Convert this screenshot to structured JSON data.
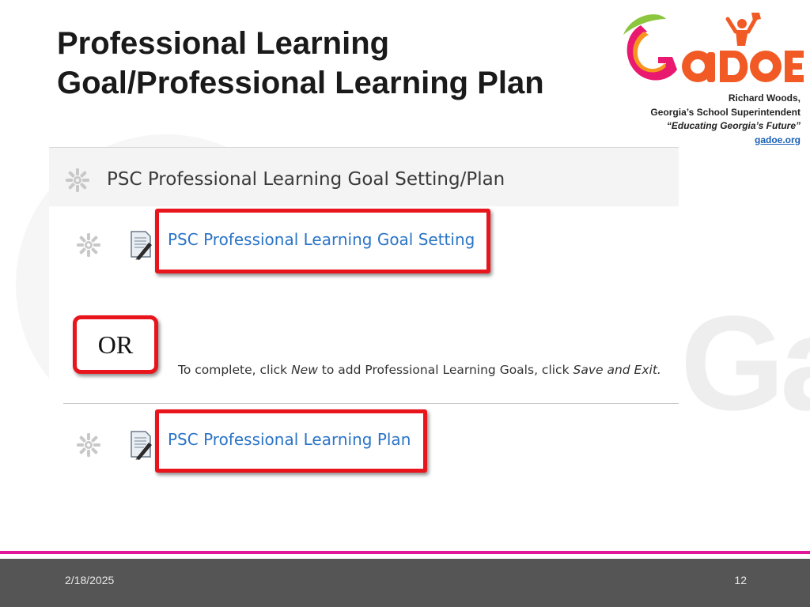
{
  "slide": {
    "title": "Professional Learning Goal/Professional Learning Plan"
  },
  "logo": {
    "icon": "gadoe-logo",
    "wordmark": "GaDOE",
    "colors": {
      "orange": "#f15a24",
      "magenta": "#d6197b",
      "green": "#8cc63f",
      "yellow": "#f7c21b"
    }
  },
  "credit": {
    "name": "Richard Woods,",
    "role": "Georgia’s School Superintendent",
    "tagline": "“Educating Georgia’s Future”",
    "link": "gadoe.org"
  },
  "screenshot": {
    "header": "PSC Professional Learning Goal Setting/Plan",
    "items": [
      {
        "label": "PSC Professional Learning Goal Setting",
        "icon": "document-pen-icon"
      },
      {
        "label": "PSC Professional Learning Plan",
        "icon": "document-pen-icon"
      }
    ],
    "or_label": "OR",
    "instruction": {
      "part1": "To complete, click ",
      "new": "New",
      "part2": " to add Professional Learning Goals, click ",
      "save": "Save and Exit."
    },
    "highlight_color": "#e8151d",
    "link_color": "#2b74c6"
  },
  "footer": {
    "date": "2/18/2025",
    "page": "12",
    "accent_color": "#e0199a"
  }
}
